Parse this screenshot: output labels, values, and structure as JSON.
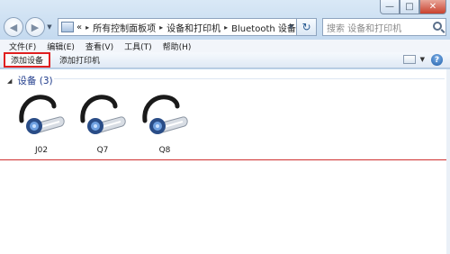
{
  "window": {
    "caption_buttons": {
      "minimize": "—",
      "maximize": "□",
      "close": "✕"
    }
  },
  "address_bar": {
    "back_glyph": "◀",
    "forward_glyph": "▶",
    "breadcrumb_prefix": "«",
    "crumbs": [
      "所有控制面板项",
      "设备和打印机",
      "Bluetooth 设备"
    ],
    "separator": "▸",
    "refresh_glyph": "↻"
  },
  "search": {
    "placeholder": "搜索 设备和打印机"
  },
  "menu": {
    "items": [
      "文件(F)",
      "编辑(E)",
      "查看(V)",
      "工具(T)",
      "帮助(H)"
    ]
  },
  "commands": {
    "add_device": "添加设备",
    "add_printer": "添加打印机",
    "help": "?"
  },
  "group": {
    "title": "设备 (3)"
  },
  "devices": [
    {
      "name": "J02"
    },
    {
      "name": "Q7"
    },
    {
      "name": "Q8"
    }
  ],
  "colors": {
    "highlight_border": "#e02020",
    "group_title": "#1e3a8a",
    "divider_red": "#d03030"
  }
}
